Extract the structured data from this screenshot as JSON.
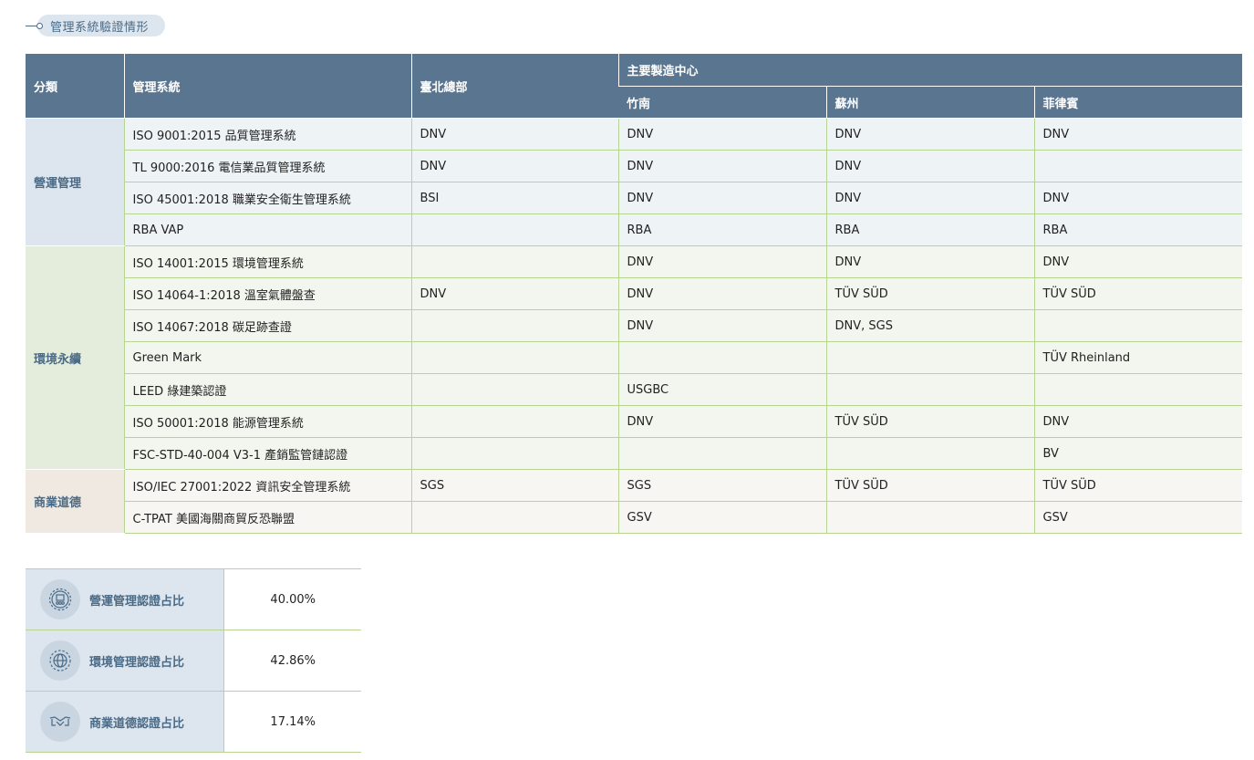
{
  "section_title": "管理系統驗證情形",
  "headers": {
    "category": "分類",
    "system": "管理系統",
    "hq": "臺北總部",
    "mfg_centers": "主要製造中心",
    "hsinchu": "竹南",
    "suzhou": "蘇州",
    "philippines": "菲律賓"
  },
  "groups": [
    {
      "category": "營運管理",
      "rows": [
        {
          "system": "ISO 9001:2015 品質管理系統",
          "hq": "DNV",
          "hsinchu": "DNV",
          "suzhou": "DNV",
          "philippines": "DNV"
        },
        {
          "system": "TL 9000:2016 電信業品質管理系統",
          "hq": "DNV",
          "hsinchu": "DNV",
          "suzhou": "DNV",
          "philippines": ""
        },
        {
          "system": "ISO 45001:2018 職業安全衛生管理系統",
          "hq": "BSI",
          "hsinchu": "DNV",
          "suzhou": "DNV",
          "philippines": "DNV"
        },
        {
          "system": "RBA VAP",
          "hq": "",
          "hsinchu": "RBA",
          "suzhou": "RBA",
          "philippines": "RBA"
        }
      ]
    },
    {
      "category": "環境永續",
      "rows": [
        {
          "system": "ISO 14001:2015 環境管理系統",
          "hq": "",
          "hsinchu": "DNV",
          "suzhou": "DNV",
          "philippines": "DNV"
        },
        {
          "system": "ISO 14064-1:2018 溫室氣體盤查",
          "hq": "DNV",
          "hsinchu": "DNV",
          "suzhou": "TÜV SÜD",
          "philippines": "TÜV SÜD"
        },
        {
          "system": "ISO 14067:2018 碳足跡查證",
          "hq": "",
          "hsinchu": "DNV",
          "suzhou": "DNV, SGS",
          "philippines": ""
        },
        {
          "system": "Green Mark",
          "hq": "",
          "hsinchu": "",
          "suzhou": "",
          "philippines": "TÜV Rheinland"
        },
        {
          "system": "LEED 綠建築認證",
          "hq": "",
          "hsinchu": "USGBC",
          "suzhou": "",
          "philippines": ""
        },
        {
          "system": "ISO 50001:2018 能源管理系統",
          "hq": "",
          "hsinchu": "DNV",
          "suzhou": "TÜV SÜD",
          "philippines": "DNV"
        },
        {
          "system": "FSC-STD-40-004 V3-1 產銷監管鏈認證",
          "hq": "",
          "hsinchu": "",
          "suzhou": "",
          "philippines": "BV"
        }
      ]
    },
    {
      "category": "商業道德",
      "rows": [
        {
          "system": "ISO/IEC 27001:2022 資訊安全管理系統",
          "hq": "SGS",
          "hsinchu": "SGS",
          "suzhou": "TÜV SÜD",
          "philippines": "TÜV SÜD"
        },
        {
          "system": "C-TPAT 美國海關商貿反恐聯盟",
          "hq": "",
          "hsinchu": "GSV",
          "suzhou": "",
          "philippines": "GSV"
        }
      ]
    }
  ],
  "stats": [
    {
      "label": "營運管理認證占比",
      "value": "40.00%",
      "icon": "operations-management-icon"
    },
    {
      "label": "環境管理認證占比",
      "value": "42.86%",
      "icon": "environment-globe-icon"
    },
    {
      "label": "商業道德認證占比",
      "value": "17.14%",
      "icon": "handshake-icon"
    }
  ],
  "colors": {
    "header_bg": "#5a7590",
    "accent_text": "#4a6a86",
    "row_border": "#b7d492"
  }
}
